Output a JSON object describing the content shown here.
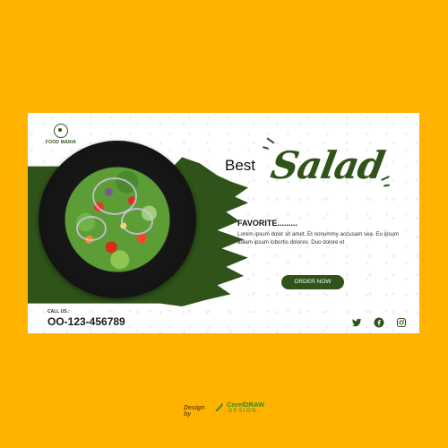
{
  "brand": {
    "name": "FOOD MANIA"
  },
  "headline": {
    "best": "Best",
    "salad": "Salad"
  },
  "content": {
    "favorite": "FAVORITE.........",
    "description": "Lorem ipsum dolor sit amet. Et nonummy accusam sea. Eu ipsum adiam ipsum lobortis dolores. Duo dolore et"
  },
  "cta": {
    "order_label": "ORDER NOW"
  },
  "contact": {
    "call_label": "CALL US :",
    "phone": "OO-123-456789"
  },
  "social": {
    "icons": [
      "twitter-icon",
      "facebook-icon",
      "instagram-icon"
    ]
  },
  "footer": {
    "design_by": "Design by",
    "brand_line1": "CorelDRAW",
    "brand_line2": "DESIGN"
  },
  "colors": {
    "background": "#FFB300",
    "accent": "#2f5318",
    "banner": "#ffffff"
  }
}
